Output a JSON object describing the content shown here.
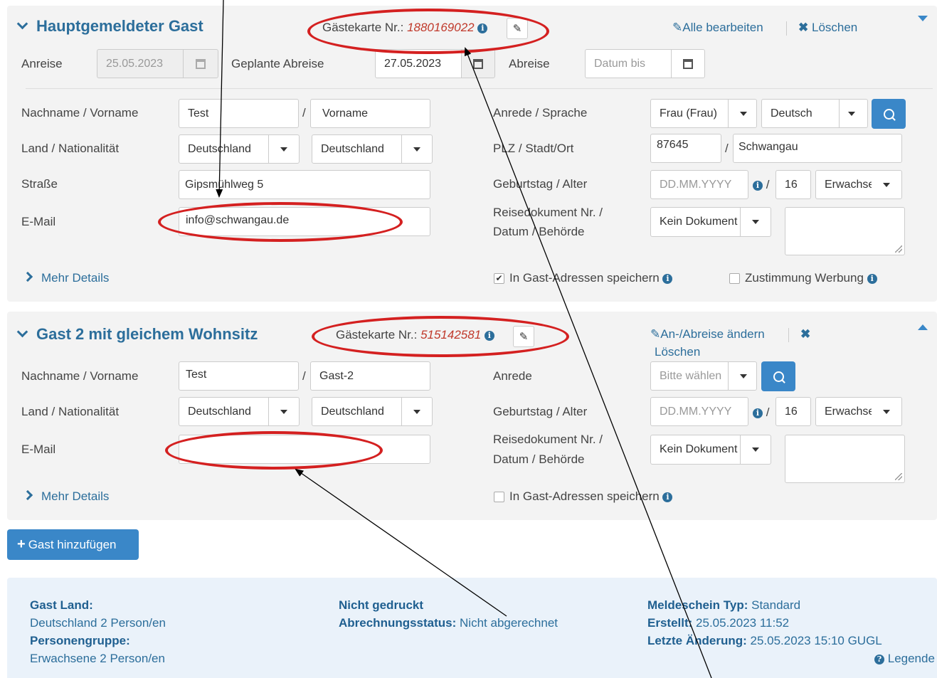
{
  "guest1": {
    "title": "Hauptgemeldeter Gast",
    "card_label": "Gästekarte Nr.:",
    "card_number": "1880169022",
    "edit_all": "Alle bearbeiten",
    "delete": "Löschen",
    "arrival_label": "Anreise",
    "arrival_value": "25.05.2023",
    "planned_departure_label": "Geplante Abreise",
    "planned_departure_value": "27.05.2023",
    "departure_label": "Abreise",
    "departure_placeholder": "Datum bis",
    "name_label": "Nachname / Vorname",
    "lastname": "Test",
    "firstname": "Vorname",
    "country_label": "Land / Nationalität",
    "country": "Deutschland",
    "nationality": "Deutschland",
    "street_label": "Straße",
    "street": "Gipsmühlweg 5",
    "email_label": "E-Mail",
    "email": "info@schwangau.de",
    "salutation_label": "Anrede / Sprache",
    "salutation": "Frau (Frau)",
    "language": "Deutsch",
    "zip_label": "PLZ / Stadt/Ort",
    "zip": "87645",
    "city": "Schwangau",
    "birthday_label": "Geburtstag / Alter",
    "birthday_placeholder": "DD.MM.YYYY",
    "age": "16",
    "age_group": "Erwachsene",
    "doc_label_1": "Reisedokument Nr. /",
    "doc_label_2": "Datum / Behörde",
    "doc_value": "Kein Dokument",
    "more_details": "Mehr Details",
    "save_address": "In Gast-Adressen speichern",
    "consent": "Zustimmung Werbung",
    "slash": "/"
  },
  "guest2": {
    "title": "Gast 2 mit gleichem Wohnsitz",
    "card_label": "Gästekarte Nr.:",
    "card_number": "515142581",
    "change_dates": "An-/Abreise ändern",
    "delete": "Löschen",
    "name_label": "Nachname / Vorname",
    "lastname": "Test",
    "firstname": "Gast-2",
    "country_label": "Land / Nationalität",
    "country": "Deutschland",
    "nationality": "Deutschland",
    "email_label": "E-Mail",
    "salutation_label": "Anrede",
    "salutation_placeholder": "Bitte wählen",
    "birthday_label": "Geburtstag / Alter",
    "birthday_placeholder": "DD.MM.YYYY",
    "age": "16",
    "age_group": "Erwachsene",
    "doc_label_1": "Reisedokument Nr. /",
    "doc_label_2": "Datum / Behörde",
    "doc_value": "Kein Dokument",
    "more_details": "Mehr Details",
    "save_address": "In Gast-Adressen speichern"
  },
  "add_guest": "Gast hinzufügen",
  "summary": {
    "country_label": "Gast Land:",
    "country_value": "Deutschland 2 Person/en",
    "group_label": "Personengruppe:",
    "group_value": "Erwachsene 2 Person/en",
    "print_status": "Nicht gedruckt",
    "billing_label": "Abrechnungsstatus:",
    "billing_value": "Nicht abgerechnet",
    "type_label": "Meldeschein Typ:",
    "type_value": "Standard",
    "created_label": "Erstellt:",
    "created_value": "25.05.2023 11:52",
    "changed_label": "Letzte Änderung:",
    "changed_value": "25.05.2023 15:10 GUGL",
    "legend": "Legende"
  },
  "colors": {
    "accent": "#2c6e9b",
    "button": "#3a87c8",
    "annotation": "#d42020"
  }
}
